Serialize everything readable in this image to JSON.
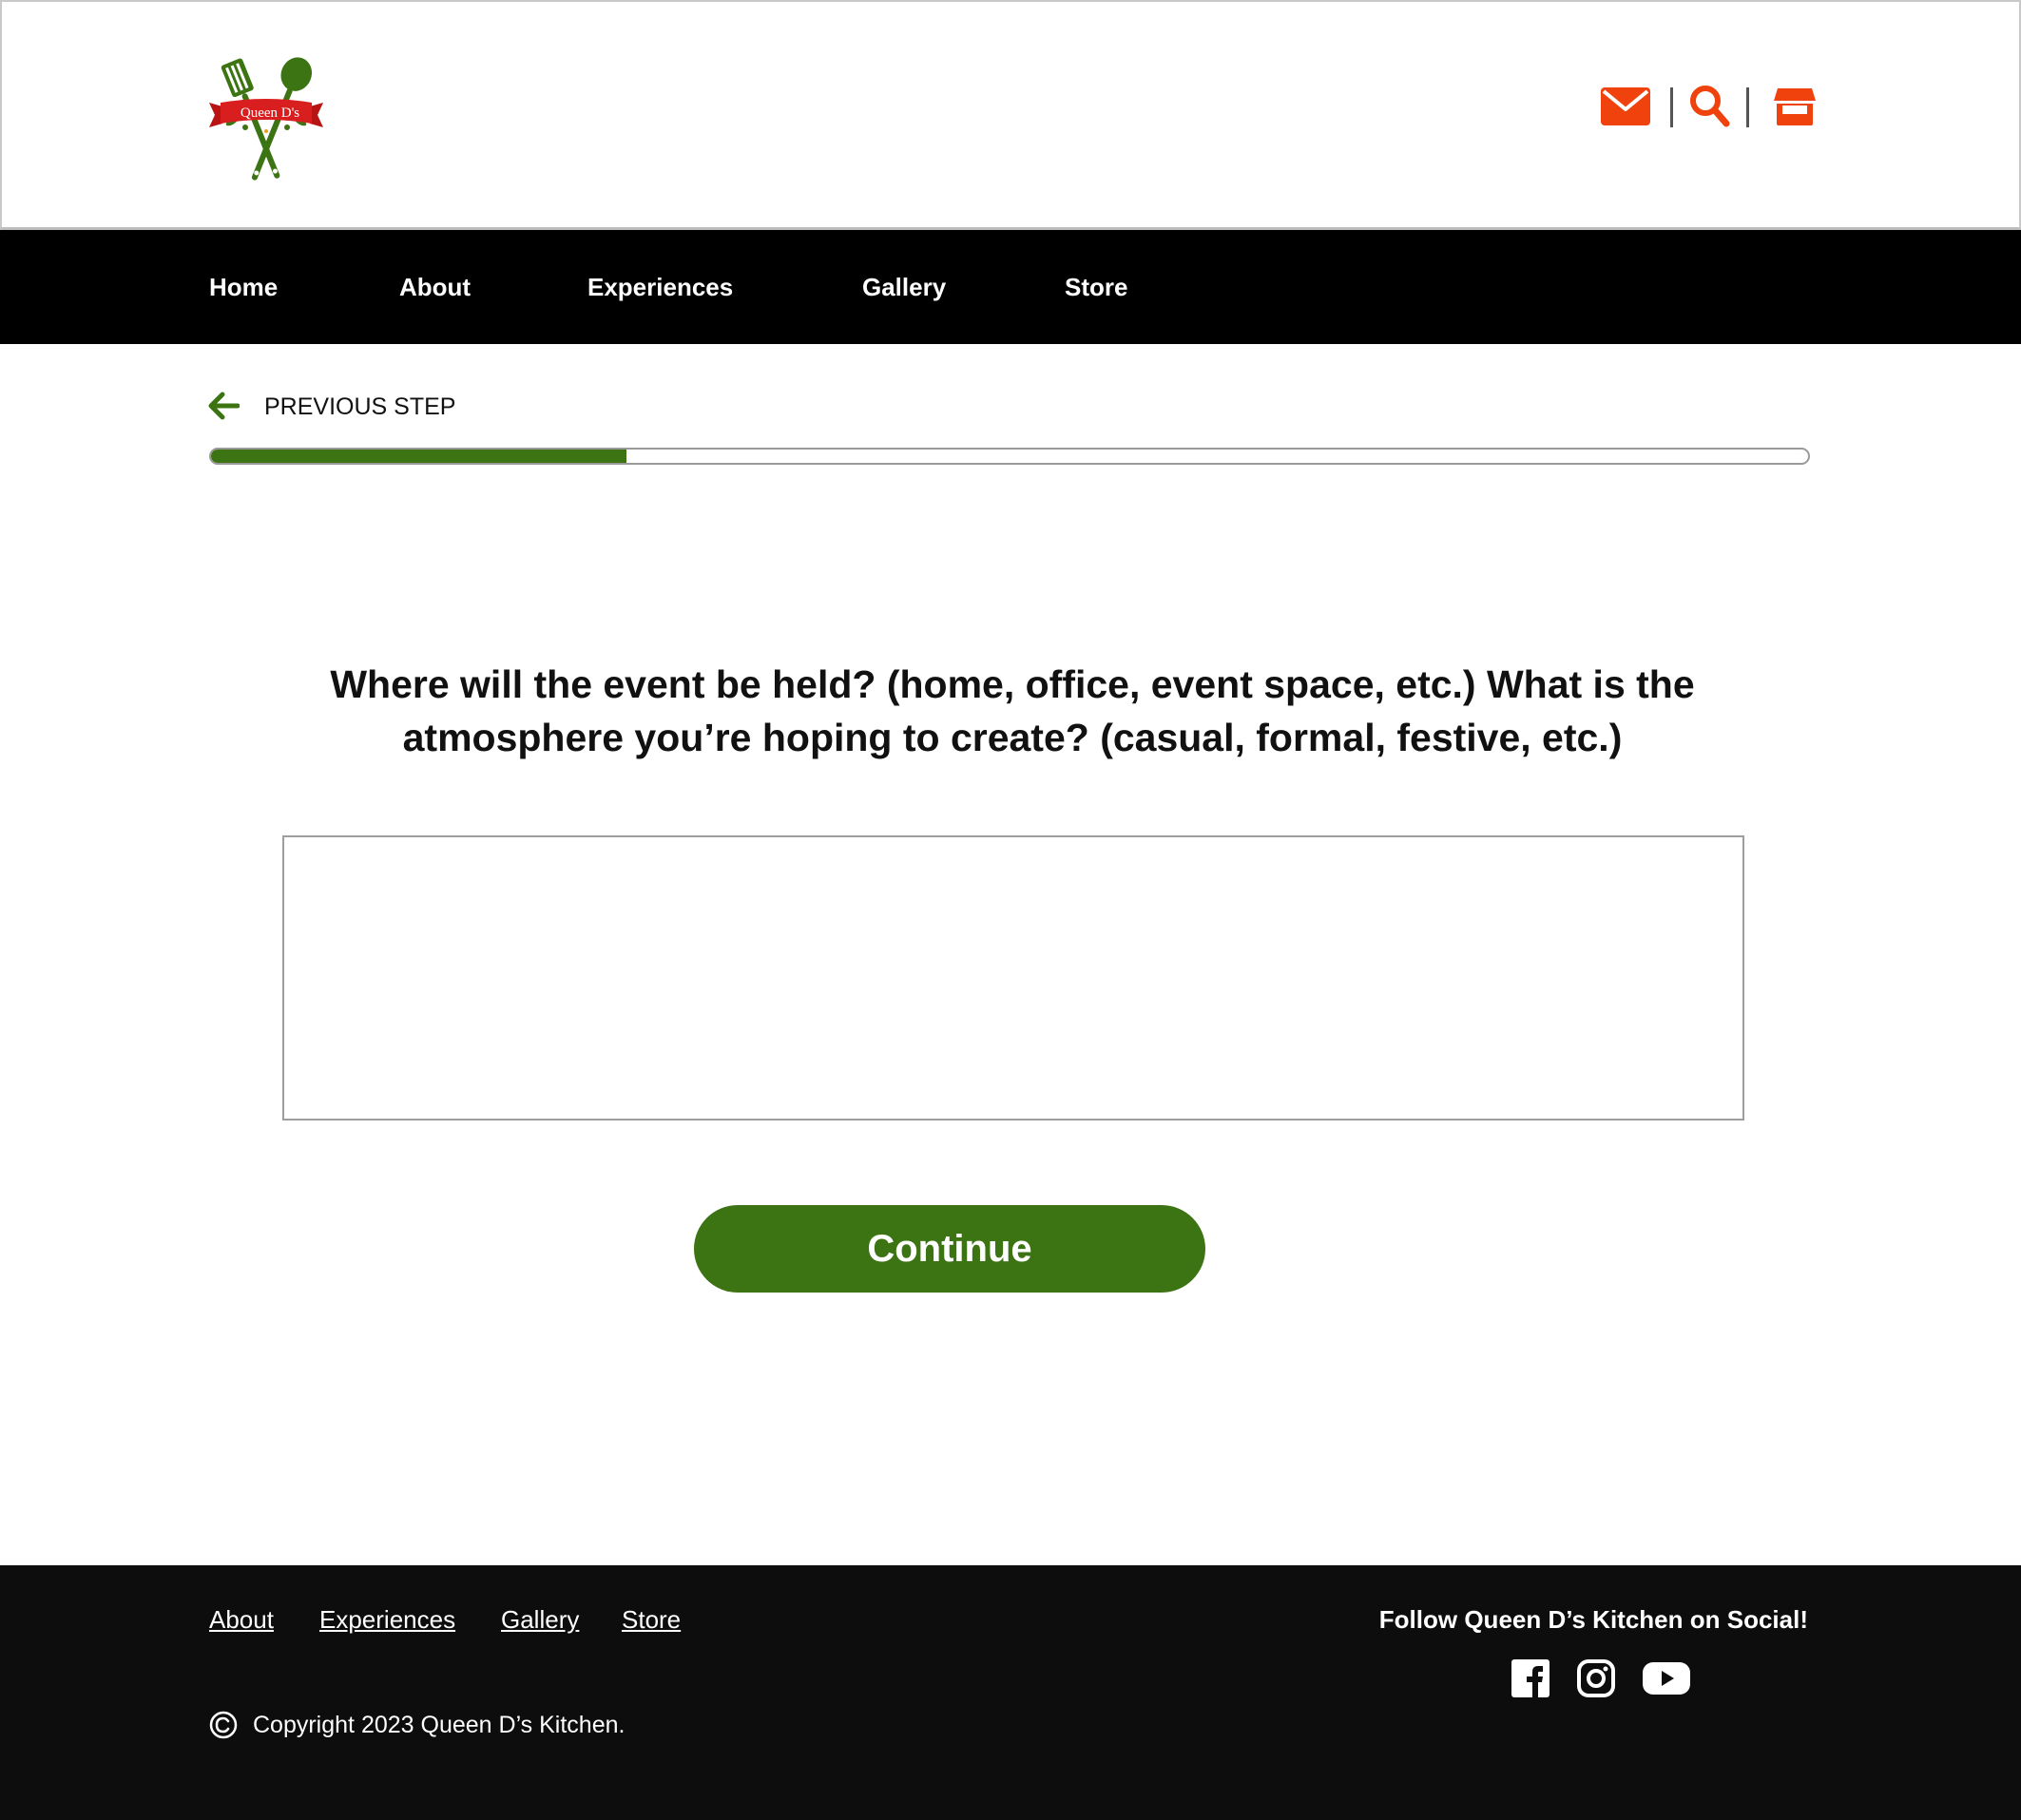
{
  "brand": {
    "logo_text": "Queen D's",
    "icon": "spatula-spoon-logo-icon"
  },
  "header_icons": [
    {
      "name": "mail-icon"
    },
    {
      "name": "search-icon"
    },
    {
      "name": "store-icon"
    }
  ],
  "nav": {
    "items": [
      "Home",
      "About",
      "Experiences",
      "Gallery",
      "Store"
    ]
  },
  "step": {
    "back_label": "PREVIOUS STEP",
    "back_icon": "arrow-left-icon",
    "progress_percent": 26
  },
  "form": {
    "question": "Where will the event be held? (home, office, event space, etc.) What is the atmosphere you’re hoping to create? (casual, formal, festive, etc.)",
    "answer_value": "",
    "continue_label": "Continue"
  },
  "footer": {
    "links": [
      "About",
      "Experiences",
      "Gallery",
      "Store"
    ],
    "follow_text": "Follow Queen D’s Kitchen on Social!",
    "social_icons": [
      "facebook-icon",
      "instagram-icon",
      "youtube-icon"
    ],
    "copyright": "Copyright 2023 Queen D’s Kitchen."
  },
  "colors": {
    "brand_green": "#3c7414",
    "accent_orange": "#f0420c",
    "nav_bg": "#000000",
    "footer_bg": "#0d0d0d"
  }
}
